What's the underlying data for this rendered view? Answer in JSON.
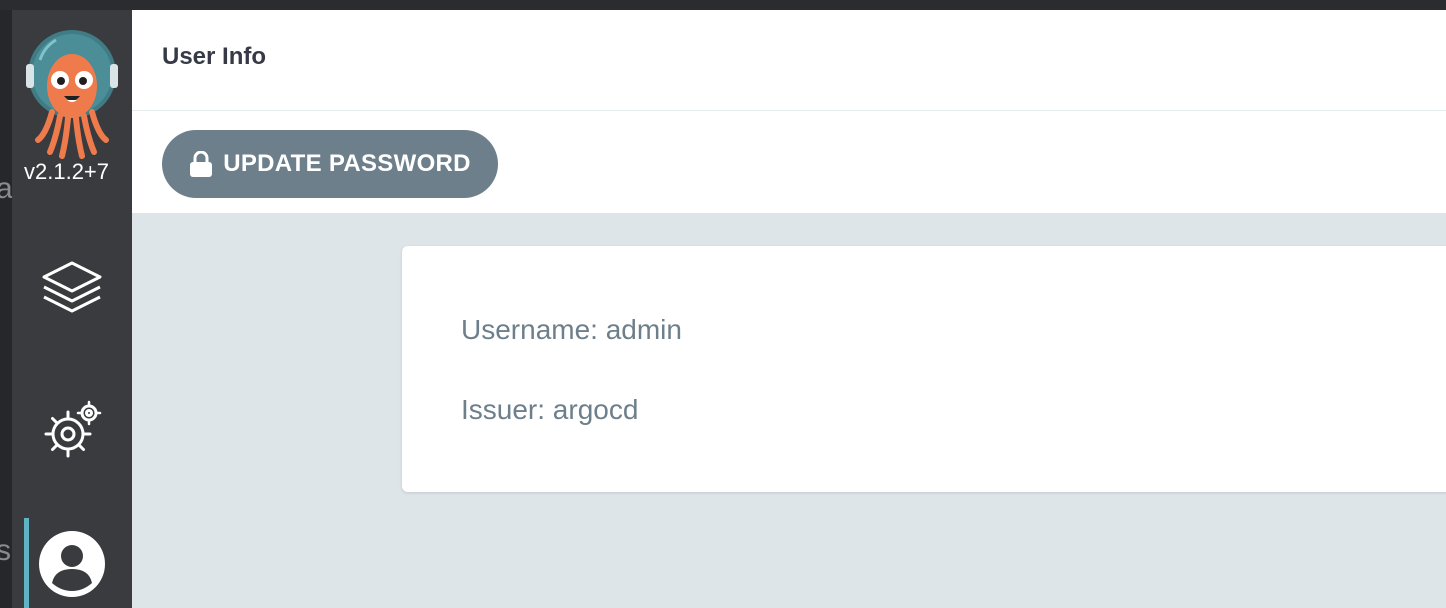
{
  "app": {
    "version": "v2.1.2+7",
    "logo_icon": "argo-octopus-logo"
  },
  "left_edge": {
    "fragments": [
      "a",
      "s"
    ]
  },
  "sidebar": {
    "items": [
      {
        "name": "applications",
        "icon": "layers-icon",
        "active": false
      },
      {
        "name": "settings",
        "icon": "gear-icon",
        "active": false
      },
      {
        "name": "user-info",
        "icon": "user-icon",
        "active": true
      }
    ]
  },
  "header": {
    "title": "User Info"
  },
  "toolbar": {
    "update_password_label": "UPDATE PASSWORD",
    "update_password_icon": "lock-icon"
  },
  "user": {
    "username_line": "Username: admin",
    "issuer_line": "Issuer: argocd"
  },
  "colors": {
    "sidebar_bg": "#3a3b3e",
    "accent": "#5fb3c5",
    "button_bg": "#6d7f8b",
    "main_bg": "#dee5e9",
    "logo_orange": "#ef7b4d",
    "helmet_teal": "#3f7c85"
  }
}
